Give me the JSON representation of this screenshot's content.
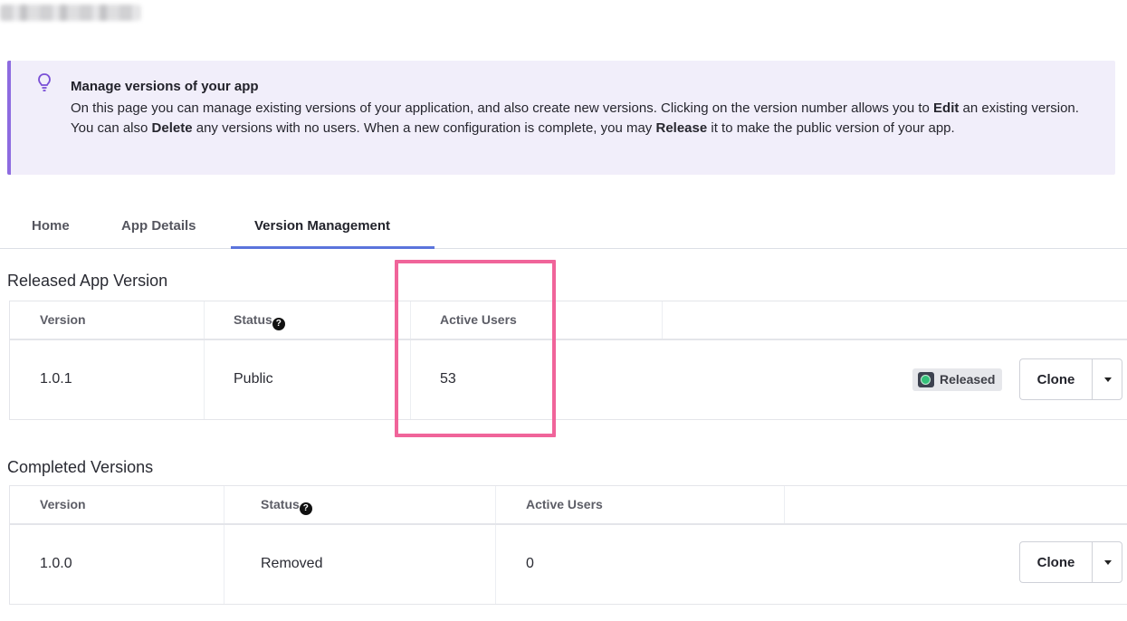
{
  "banner": {
    "title": "Manage versions of your app",
    "text_1": "On this page you can manage existing versions of your application, and also create new versions. Clicking on the version number allows you to",
    "bold_edit": "Edit",
    "text_2": " an existing version. You can also ",
    "bold_delete": "Delete",
    "text_3": " any versions with no users. When a new configuration is complete, you may ",
    "bold_release": "Release",
    "text_4": " it to make the public version of your app.",
    "icon": "lightbulb-icon",
    "accent_color": "#8d6be0"
  },
  "tabs": [
    {
      "label": "Home"
    },
    {
      "label": "App Details"
    },
    {
      "label": "Version Management",
      "active": true
    }
  ],
  "released_section": {
    "title": "Released App Version",
    "columns": [
      "Version",
      "Status",
      "Active Users"
    ],
    "rows": [
      {
        "version": "1.0.1",
        "status": "Public",
        "active_users": "53",
        "badge": "Released",
        "action": "Clone"
      }
    ]
  },
  "completed_section": {
    "title": "Completed Versions",
    "columns": [
      "Version",
      "Status",
      "Active Users"
    ],
    "rows": [
      {
        "version": "1.0.0",
        "status": "Removed",
        "active_users": "0",
        "action": "Clone"
      }
    ]
  },
  "colors": {
    "tab_active_underline": "#5b74dc",
    "highlight": "#f0649a",
    "released_dot": "#35c07a"
  }
}
